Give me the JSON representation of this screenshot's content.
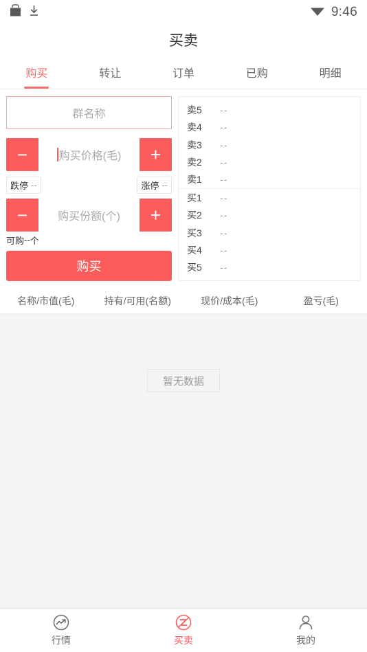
{
  "statusbar": {
    "icons": [
      "shopping-bag-icon",
      "download-icon",
      "wifi-icon"
    ],
    "time": "9:46"
  },
  "header": {
    "title": "买卖"
  },
  "tabs": [
    {
      "label": "购买",
      "active": true
    },
    {
      "label": "转让",
      "active": false
    },
    {
      "label": "订单",
      "active": false
    },
    {
      "label": "已购",
      "active": false
    },
    {
      "label": "明细",
      "active": false
    }
  ],
  "trade": {
    "group_name": {
      "placeholder": "群名称",
      "value": ""
    },
    "price": {
      "placeholder": "购买价格(毛)",
      "value": "",
      "minus_label": "−",
      "plus_label": "+",
      "focused": true
    },
    "limits": {
      "down_label": "跌停",
      "down_value": "--",
      "up_label": "涨停",
      "up_value": "--"
    },
    "shares": {
      "placeholder": "购买份额(个)",
      "value": "",
      "minus_label": "−",
      "plus_label": "+"
    },
    "available": {
      "label": "可购",
      "value": "--",
      "unit": "个"
    },
    "submit_label": "购买"
  },
  "orderbook": {
    "rows": [
      {
        "label": "卖5",
        "value": "--"
      },
      {
        "label": "卖4",
        "value": "--"
      },
      {
        "label": "卖3",
        "value": "--"
      },
      {
        "label": "卖2",
        "value": "--"
      },
      {
        "label": "卖1",
        "value": "--"
      },
      {
        "label": "买1",
        "value": "--"
      },
      {
        "label": "买2",
        "value": "--"
      },
      {
        "label": "买3",
        "value": "--"
      },
      {
        "label": "买4",
        "value": "--"
      },
      {
        "label": "买5",
        "value": "--"
      }
    ]
  },
  "holdings": {
    "columns": [
      "名称/市值(毛)",
      "持有/可用(名额)",
      "现价/成本(毛)",
      "盈亏(毛)"
    ],
    "rows": [],
    "empty_label": "暂无数据"
  },
  "bottomnav": [
    {
      "label": "行情",
      "icon": "market-trend-icon",
      "active": false
    },
    {
      "label": "买卖",
      "icon": "trade-z-icon",
      "active": true
    },
    {
      "label": "我的",
      "icon": "person-icon",
      "active": false
    }
  ],
  "colors": {
    "accent": "#fb5c5c",
    "accent_soft": "#f76b6b",
    "border_soft": "#f1a5a8",
    "text_primary": "#333333",
    "text_secondary": "#666666",
    "text_muted": "#9a9a9a",
    "page_bg": "#f4f4f4"
  }
}
